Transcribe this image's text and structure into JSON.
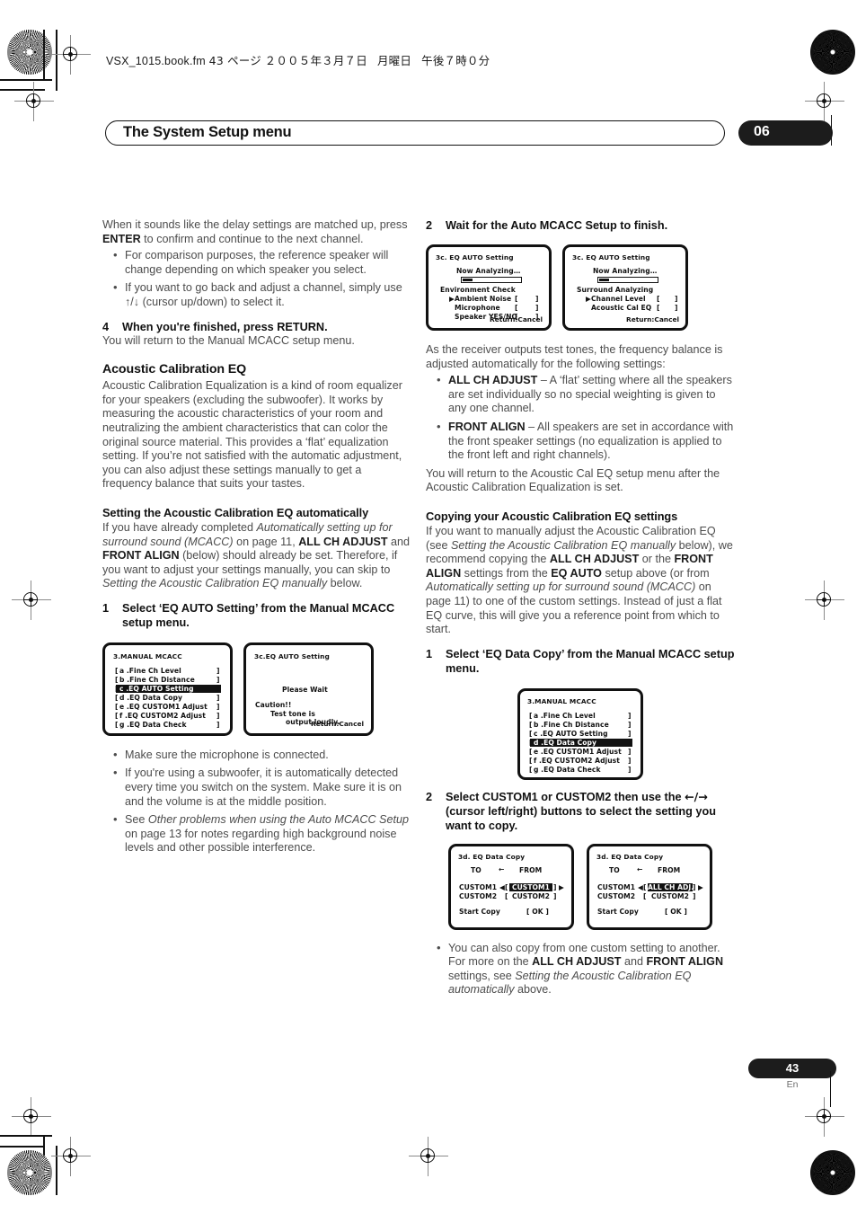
{
  "fileinfo": {
    "filename": "VSX_1015.book.fm",
    "page_marker": "43 ページ",
    "date": "２００５年３月７日",
    "weekday": "月曜日",
    "time": "午後７時０分"
  },
  "header": {
    "title": "The System Setup menu",
    "chapter_number": "06"
  },
  "footer": {
    "page_number": "43",
    "language": "En"
  },
  "left_column": {
    "intro": {
      "p1_a": "When it sounds like the delay settings are matched up, press ",
      "p1_b": "ENTER",
      "p1_c": " to confirm and continue to the next channel.",
      "bullets": [
        "For comparison purposes, the reference speaker will change depending on which speaker you select.",
        "If you want to go back and adjust a channel, simply use ↑/↓ (cursor up/down) to select it."
      ]
    },
    "step4": {
      "num": "4",
      "text": "When you're finished, press RETURN.",
      "body": "You will return to the Manual MCACC setup menu."
    },
    "acoustic_cal_eq": {
      "heading": "Acoustic Calibration EQ",
      "body": "Acoustic Calibration Equalization is a kind of room equalizer for your speakers (excluding the subwoofer). It works by measuring the acoustic characteristics of your room and neutralizing the ambient characteristics that can color the original source material. This provides a ‘flat’ equalization setting. If you’re not satisfied with the automatic adjustment, you can also adjust these settings manually to get a frequency balance that suits your tastes."
    },
    "auto_section": {
      "heading": "Setting the Acoustic Calibration EQ automatically",
      "p_a": "If you have already completed ",
      "p_b": "Automatically setting up for surround sound (MCACC)",
      "p_c": " on page 11, ",
      "p_d": "ALL CH ADJUST",
      "p_e": " and ",
      "p_f": "FRONT ALIGN",
      "p_g": " (below) should already be set. Therefore, if you want to adjust your settings manually, you can skip to ",
      "p_h": "Setting the Acoustic Calibration EQ manually",
      "p_i": " below."
    },
    "step1": {
      "num": "1",
      "text": "Select ‘EQ AUTO Setting’ from the Manual MCACC setup menu."
    },
    "notes": [
      "Make sure the microphone is connected.",
      "If you're using a subwoofer, it is automatically detected every time you switch on the system. Make sure it is on and the volume is at the middle position."
    ],
    "note3": {
      "a": "See ",
      "b": "Other problems when using the Auto MCACC Setup",
      "c": " on page 13 for notes regarding high background noise levels and other possible interference."
    }
  },
  "right_column": {
    "step2": {
      "num": "2",
      "text": "Wait for the Auto MCACC Setup to finish."
    },
    "test_tone_intro": "As the receiver outputs test tones, the frequency balance is adjusted automatically for the following settings:",
    "settings_bullets": [
      {
        "term": "ALL CH ADJUST",
        "desc": " – A ‘flat’ setting where all the speakers are set individually so no special weighting is given to any one channel."
      },
      {
        "term": "FRONT ALIGN",
        "desc": " – All speakers are set in accordance with the front speaker settings (no equalization is applied to the front left and right channels)."
      }
    ],
    "after_text": "You will return to the Acoustic Cal EQ setup menu after the Acoustic Calibration Equalization is set.",
    "copying_section": {
      "heading": "Copying your Acoustic Calibration EQ settings",
      "p_a": "If you want to manually adjust the Acoustic Calibration EQ (see ",
      "p_b": "Setting the Acoustic Calibration EQ manually",
      "p_c": " below), we recommend copying the ",
      "p_d": "ALL CH ADJUST",
      "p_e": " or the ",
      "p_f": "FRONT ALIGN",
      "p_g": " settings from the ",
      "p_h": "EQ AUTO",
      "p_i": " setup above (or from ",
      "p_j": "Automatically setting up for surround sound (MCACC)",
      "p_k": " on page 11) to one of the custom settings. Instead of just a flat EQ curve, this will give you a reference point from which to start."
    },
    "step1": {
      "num": "1",
      "text": "Select ‘EQ Data Copy’ from the Manual MCACC setup menu."
    },
    "step2b": {
      "num": "2",
      "text_a": "Select CUSTOM1 or CUSTOM2 then use the ",
      "arrows": "←/→",
      "text_b": " (cursor left/right) buttons to select the setting you want to copy."
    },
    "final_note": {
      "a": "You can also copy from one custom setting to another. For more on the ",
      "b": "ALL CH ADJUST",
      "c": " and ",
      "d": "FRONT ALIGN",
      "e": " settings, see ",
      "f": "Setting the Acoustic Calibration EQ automatically",
      "g": " above."
    }
  },
  "screens": {
    "manual_mcacc_left": {
      "title": "3.MANUAL MCACC",
      "items": [
        "a .Fine Ch Level",
        "b .Fine Ch Distance",
        "c .EQ AUTO Setting",
        "d .EQ Data Copy",
        "e .EQ CUSTOM1 Adjust",
        "f .EQ CUSTOM2 Adjust",
        "g .EQ Data Check"
      ],
      "highlighted_index": 2
    },
    "eq_auto_wait": {
      "title": "3c.EQ AUTO Setting",
      "please_wait": "Please Wait",
      "caution": "Caution!!",
      "caution_l1": "Test tone is",
      "caution_l2": "output loudly.",
      "return": "Return:Cancel"
    },
    "eq_auto_env": {
      "title": "3c. EQ AUTO Setting",
      "analyzing": "Now Analyzing…",
      "stage": "Environment Check",
      "rows": [
        {
          "cursor": true,
          "label": "Ambient Noise"
        },
        {
          "cursor": false,
          "label": "Microphone"
        },
        {
          "cursor": false,
          "label": "Speaker YES/NO"
        }
      ],
      "return": "Return:Cancel"
    },
    "eq_auto_surround": {
      "title": "3c. EQ AUTO Setting",
      "analyzing": "Now Analyzing…",
      "stage": "Surround Analyzing",
      "rows": [
        {
          "cursor": true,
          "label": "Channel Level"
        },
        {
          "cursor": false,
          "label": "Acoustic Cal EQ"
        }
      ],
      "return": "Return:Cancel"
    },
    "manual_mcacc_right": {
      "title": "3.MANUAL MCACC",
      "items": [
        "a .Fine Ch Level",
        "b .Fine Ch Distance",
        "c .EQ AUTO Setting",
        "d .EQ Data Copy",
        "e .EQ CUSTOM1 Adjust",
        "f .EQ CUSTOM2 Adjust",
        "g .EQ Data Check"
      ],
      "highlighted_index": 3
    },
    "eq_data_copy_1": {
      "title": "3d. EQ Data Copy",
      "to_label": "TO",
      "arrow": "←",
      "from_label": "FROM",
      "row1_left": "CUSTOM1",
      "row1_value": "CUSTOM1",
      "row2_left": "CUSTOM2",
      "row2_value": "CUSTOM2",
      "start_copy": "Start Copy",
      "ok": "[  OK  ]"
    },
    "eq_data_copy_2": {
      "title": "3d. EQ Data Copy",
      "to_label": "TO",
      "arrow": "←",
      "from_label": "FROM",
      "row1_left": "CUSTOM1",
      "row1_value": "ALL CH ADJ.",
      "row2_left": "CUSTOM2",
      "row2_value": "CUSTOM2",
      "start_copy": "Start Copy",
      "ok": "[  OK  ]"
    }
  }
}
